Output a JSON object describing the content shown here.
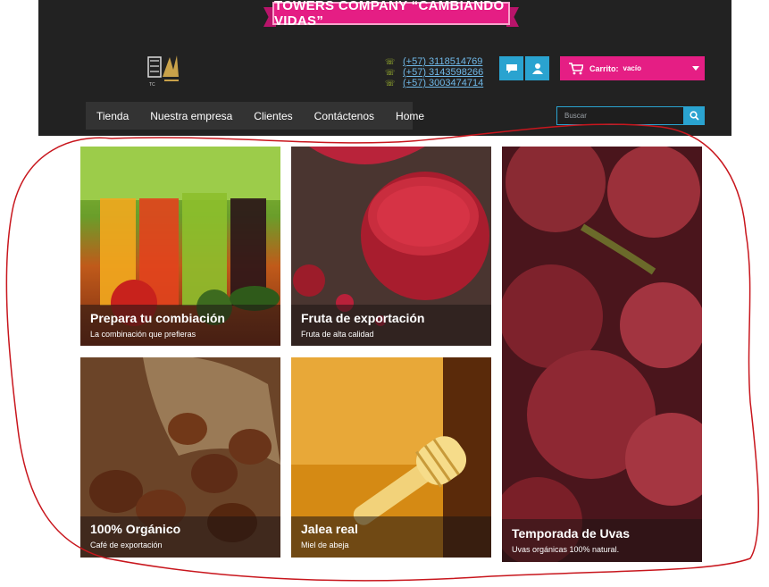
{
  "banner": {
    "text": "TOWERS COMPANY “CAMBIANDO VIDAS”"
  },
  "phones": [
    "(+57) 3118514769",
    "(+57) 3143598266",
    "(+57) 3003474714"
  ],
  "icons": {
    "chat": "chat-icon",
    "user": "user-icon",
    "cart": "cart-icon",
    "search": "search-icon",
    "phone": "phone-icon"
  },
  "cart": {
    "label": "Carrito:",
    "value": "vacío"
  },
  "nav": {
    "items": [
      "Tienda",
      "Nuestra empresa",
      "Clientes",
      "Contáctenos",
      "Home"
    ]
  },
  "search": {
    "placeholder": "Buscar"
  },
  "tiles": [
    {
      "title": "Prepara tu combiación",
      "subtitle": "La combinación que prefieras"
    },
    {
      "title": "Fruta de exportación",
      "subtitle": "Fruta de alta calidad"
    },
    {
      "title": "100% Orgánico",
      "subtitle": "Café de exportación"
    },
    {
      "title": "Jalea real",
      "subtitle": "Miel de abeja"
    },
    {
      "title": "Temporada de Uvas",
      "subtitle": "Uvas orgánicas 100% natural."
    }
  ],
  "colors": {
    "accent_pink": "#e51e84",
    "accent_blue": "#2aa3d0",
    "header_bg": "#222222",
    "annotation_red": "#c8161d"
  }
}
